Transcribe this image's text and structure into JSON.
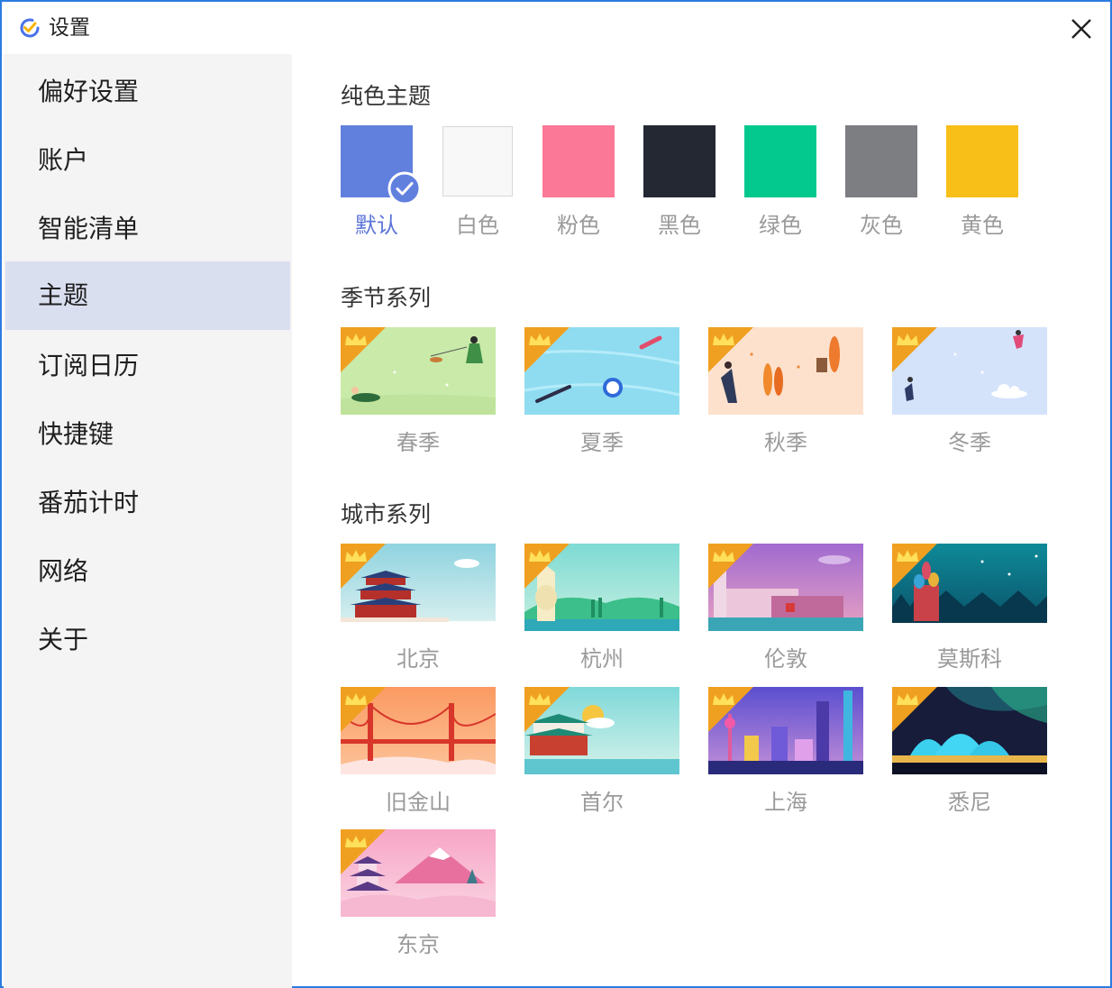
{
  "window": {
    "title": "设置",
    "accent": "#2b7be0"
  },
  "sidebar": {
    "items": [
      {
        "label": "偏好设置"
      },
      {
        "label": "账户"
      },
      {
        "label": "智能清单"
      },
      {
        "label": "主题",
        "active": true
      },
      {
        "label": "订阅日历"
      },
      {
        "label": "快捷键"
      },
      {
        "label": "番茄计时"
      },
      {
        "label": "网络"
      },
      {
        "label": "关于"
      }
    ],
    "active_bg": "#dadff0"
  },
  "solid": {
    "title": "纯色主题",
    "swatches": [
      {
        "label": "默认",
        "color": "#6180de",
        "selected": true
      },
      {
        "label": "白色",
        "color": "#f8f8f8"
      },
      {
        "label": "粉色",
        "color": "#fb7896"
      },
      {
        "label": "黑色",
        "color": "#232833"
      },
      {
        "label": "绿色",
        "color": "#04c98e"
      },
      {
        "label": "灰色",
        "color": "#7d7e82"
      },
      {
        "label": "黄色",
        "color": "#f9bf19"
      }
    ]
  },
  "seasons": {
    "title": "季节系列",
    "cards": [
      {
        "label": "春季",
        "icon": "crown-icon"
      },
      {
        "label": "夏季",
        "icon": "crown-icon"
      },
      {
        "label": "秋季",
        "icon": "crown-icon"
      },
      {
        "label": "冬季",
        "icon": "crown-icon"
      }
    ]
  },
  "cities": {
    "title": "城市系列",
    "cards": [
      {
        "label": "北京",
        "icon": "crown-icon"
      },
      {
        "label": "杭州",
        "icon": "crown-icon"
      },
      {
        "label": "伦敦",
        "icon": "crown-icon"
      },
      {
        "label": "莫斯科",
        "icon": "crown-icon"
      },
      {
        "label": "旧金山",
        "icon": "crown-icon"
      },
      {
        "label": "首尔",
        "icon": "crown-icon"
      },
      {
        "label": "上海",
        "icon": "crown-icon"
      },
      {
        "label": "悉尼",
        "icon": "crown-icon"
      },
      {
        "label": "东京",
        "icon": "crown-icon"
      }
    ]
  }
}
